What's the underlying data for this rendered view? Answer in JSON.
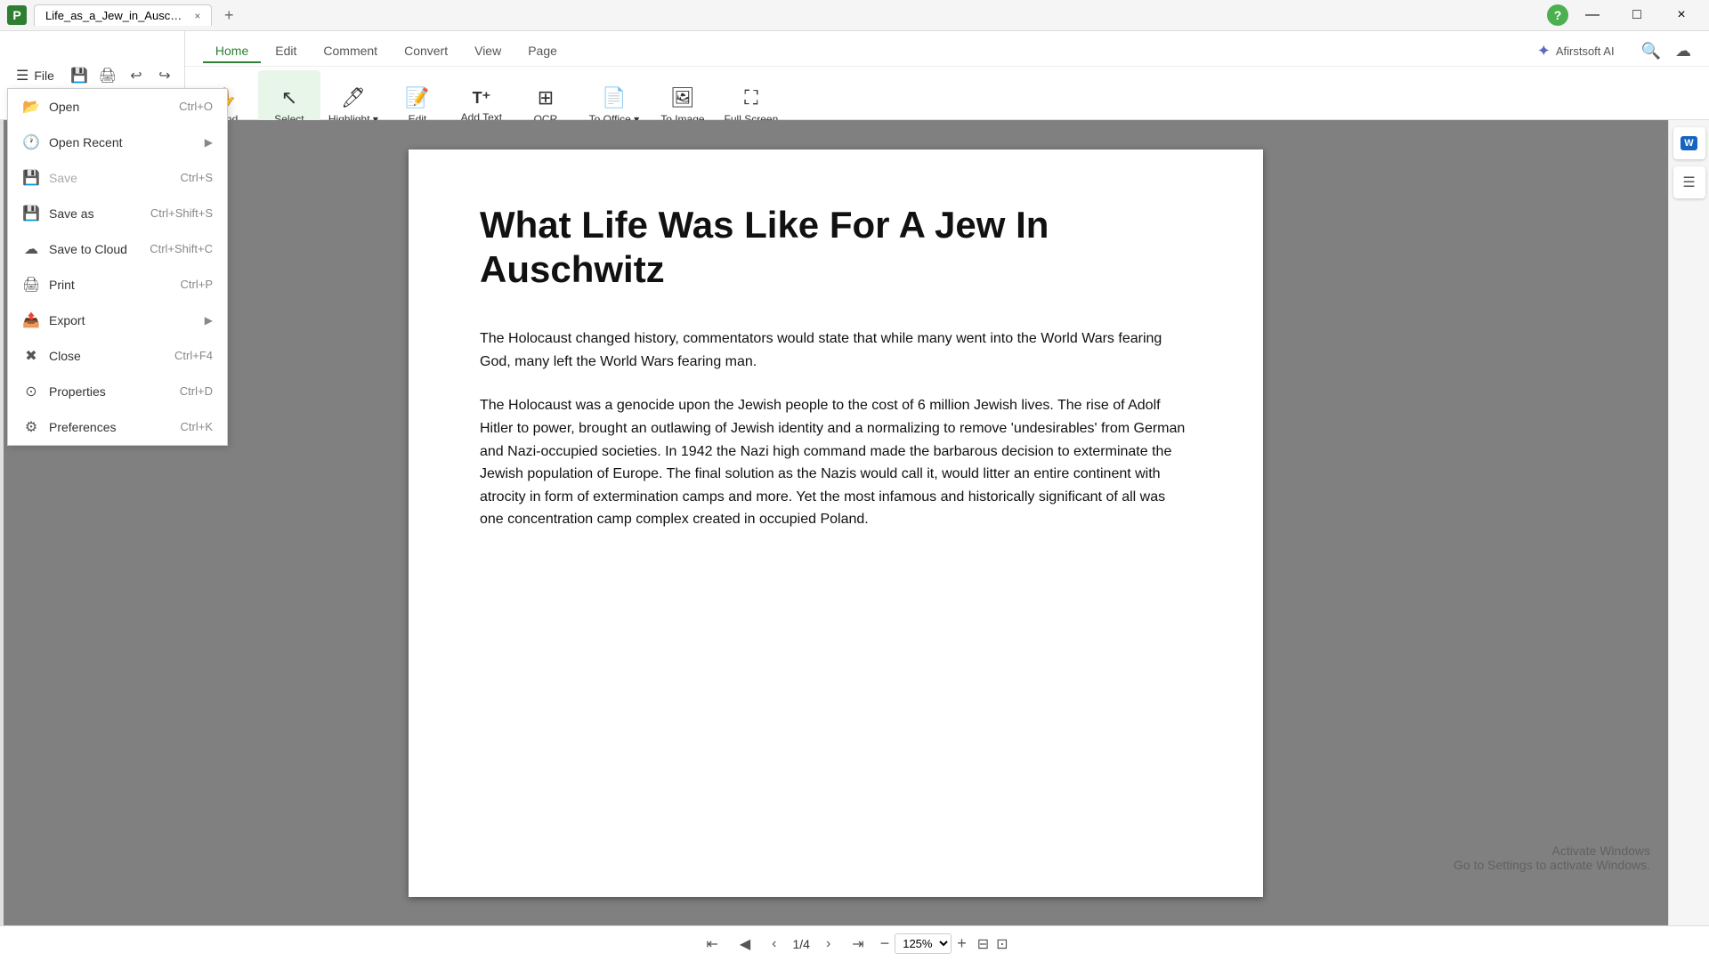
{
  "titleBar": {
    "tabTitle": "Life_as_a_Jew_in_Auschw...",
    "closeTab": "×",
    "addTab": "+",
    "winMinimize": "—",
    "winMaximize": "□",
    "winClose": "×"
  },
  "helpIcon": "?",
  "toolbar": {
    "fileLabel": "File",
    "navTabs": [
      "Home",
      "Edit",
      "Comment",
      "Convert",
      "View",
      "Page"
    ],
    "activeTab": "Home",
    "aiLabel": "Afirstsoft AI",
    "tools": [
      {
        "id": "hand",
        "icon": "✋",
        "label": "Hand"
      },
      {
        "id": "select",
        "icon": "↖",
        "label": "Select",
        "active": true
      },
      {
        "id": "highlight",
        "icon": "✏️",
        "label": "Highlight",
        "hasArrow": true
      },
      {
        "id": "edit",
        "icon": "📝",
        "label": "Edit"
      },
      {
        "id": "addtext",
        "icon": "T+",
        "label": "Add Text"
      },
      {
        "id": "ocr",
        "icon": "🔤",
        "label": "OCR"
      },
      {
        "id": "tooffice",
        "icon": "📄",
        "label": "To Office",
        "hasArrow": true
      },
      {
        "id": "toimage",
        "icon": "🖼",
        "label": "To Image"
      },
      {
        "id": "fullscreen",
        "icon": "⛶",
        "label": "Full Screen"
      }
    ]
  },
  "fileMenu": {
    "items": [
      {
        "id": "open",
        "icon": "📂",
        "label": "Open",
        "shortcut": "Ctrl+O"
      },
      {
        "id": "openrecent",
        "icon": "🕐",
        "label": "Open Recent",
        "arrow": true
      },
      {
        "id": "save",
        "icon": "💾",
        "label": "Save",
        "shortcut": "Ctrl+S",
        "disabled": true
      },
      {
        "id": "saveas",
        "icon": "💾",
        "label": "Save as",
        "shortcut": "Ctrl+Shift+S"
      },
      {
        "id": "savecloud",
        "icon": "☁",
        "label": "Save to Cloud",
        "shortcut": "Ctrl+Shift+C"
      },
      {
        "id": "print",
        "icon": "🖨",
        "label": "Print",
        "shortcut": "Ctrl+P"
      },
      {
        "id": "export",
        "icon": "📤",
        "label": "Export",
        "arrow": true
      },
      {
        "id": "close",
        "icon": "✖",
        "label": "Close",
        "shortcut": "Ctrl+F4"
      },
      {
        "id": "properties",
        "icon": "⚙",
        "label": "Properties",
        "shortcut": "Ctrl+D"
      },
      {
        "id": "preferences",
        "icon": "⚙",
        "label": "Preferences",
        "shortcut": "Ctrl+K"
      }
    ]
  },
  "pdf": {
    "title": "What Life Was Like For A Jew In Auschwitz",
    "paragraphs": [
      "The Holocaust changed history, commentators would state that while many went into the World Wars fearing God, many left the World Wars fearing man.",
      "The Holocaust was a genocide upon the Jewish people to the cost of 6 million Jewish lives. The rise of Adolf Hitler to power, brought an outlawing of Jewish identity and a normalizing to remove 'undesirables' from German and Nazi-occupied societies. In 1942 the Nazi high command made the barbarous decision to exterminate the Jewish population of Europe. The final solution as the Nazis would call it, would litter an entire continent with atrocity in form of extermination camps and more. Yet the most infamous and historically significant of all was one concentration camp complex created in occupied Poland."
    ]
  },
  "statusBar": {
    "pageInfo": "1/4",
    "zoomLevel": "125%",
    "activateText": "Activate Windows",
    "activateSub": "Go to Settings to activate Windows."
  }
}
